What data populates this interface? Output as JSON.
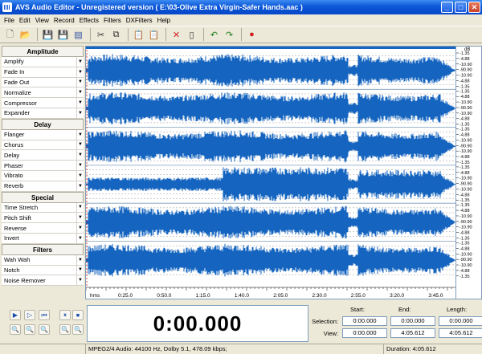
{
  "window": {
    "title": "AVS Audio Editor - Unregistered version ( E:\\03-Olive Extra Virgin-Safer Hands.aac )",
    "min_label": "_",
    "max_label": "□",
    "close_label": "✕"
  },
  "menu": [
    "File",
    "Edit",
    "View",
    "Record",
    "Effects",
    "Filters",
    "DXFilters",
    "Help"
  ],
  "toolbar": [
    {
      "name": "new-icon",
      "glyph": "🗋",
      "color": "#555555"
    },
    {
      "name": "open-icon",
      "glyph": "📂",
      "color": "#c8a030"
    },
    {
      "sep": true
    },
    {
      "name": "save-icon",
      "glyph": "💾",
      "color": "#3050a0"
    },
    {
      "name": "save-as-icon",
      "glyph": "💾",
      "color": "#3050a0"
    },
    {
      "name": "properties-icon",
      "glyph": "▤",
      "color": "#3050a0"
    },
    {
      "sep": true
    },
    {
      "name": "cut-icon",
      "glyph": "✂",
      "color": "#333333"
    },
    {
      "name": "copy-icon",
      "glyph": "⧉",
      "color": "#333333"
    },
    {
      "sep": true
    },
    {
      "name": "paste-icon",
      "glyph": "📋",
      "color": "#7a5a20"
    },
    {
      "name": "paste-mix-icon",
      "glyph": "📋",
      "color": "#7a5a20"
    },
    {
      "sep": true
    },
    {
      "name": "delete-icon",
      "glyph": "✕",
      "color": "#d02020"
    },
    {
      "name": "trim-icon",
      "glyph": "▯",
      "color": "#333333"
    },
    {
      "sep": true
    },
    {
      "name": "undo-icon",
      "glyph": "↶",
      "color": "#208020"
    },
    {
      "name": "redo-icon",
      "glyph": "↷",
      "color": "#208020"
    },
    {
      "sep": true
    },
    {
      "name": "record-icon",
      "glyph": "●",
      "color": "#d02020"
    }
  ],
  "sidebar": {
    "groups": [
      {
        "title": "Amplitude",
        "items": [
          "Amplify",
          "Fade In",
          "Fade Out",
          "Normalize",
          "Compressor",
          "Expander"
        ]
      },
      {
        "title": "Delay",
        "items": [
          "Flanger",
          "Chorus",
          "Delay",
          "Phaser",
          "Vibrato",
          "Reverb"
        ]
      },
      {
        "title": "Special",
        "items": [
          "Time Stretch",
          "Pitch Shift",
          "Reverse",
          "Invert"
        ]
      },
      {
        "title": "Filters",
        "items": [
          "Wah Wah",
          "Notch",
          "Noise Remover"
        ]
      }
    ],
    "arrow": "▼"
  },
  "waveform": {
    "channels": 6,
    "color": "#1565c0",
    "time_labels": [
      "hms",
      "0:25.0",
      "0:50.0",
      "1:15.0",
      "1:40.0",
      "2:05.0",
      "2:30.0",
      "2:55.0",
      "3:20.0",
      "3:45.0"
    ],
    "db_unit": "dB",
    "db_labels": [
      "-1.35",
      "-4.88",
      "-10.90",
      "-90.90",
      "-10.90",
      "-4.88",
      "-1.35"
    ]
  },
  "transport": {
    "buttons": [
      "▶",
      "▷",
      "⏮",
      "⏸",
      "⏹",
      "⏵",
      "🔍",
      "🔍",
      "🔍",
      "🔍",
      "🔍"
    ]
  },
  "timer": "0:00.000",
  "selection_table": {
    "headers": [
      "Start:",
      "End:",
      "Length:"
    ],
    "rows": [
      {
        "label": "Selection:",
        "values": [
          "0:00.000",
          "0:00.000",
          "0:00.000"
        ]
      },
      {
        "label": "View:",
        "values": [
          "0:00.000",
          "4:05.612",
          "4:05.612"
        ]
      }
    ]
  },
  "status": {
    "format": "MPEG2/4 Audio: 44100 Hz,  Dolby 5.1, 478.09 kbps;",
    "duration": "Duration: 4:05.612"
  }
}
